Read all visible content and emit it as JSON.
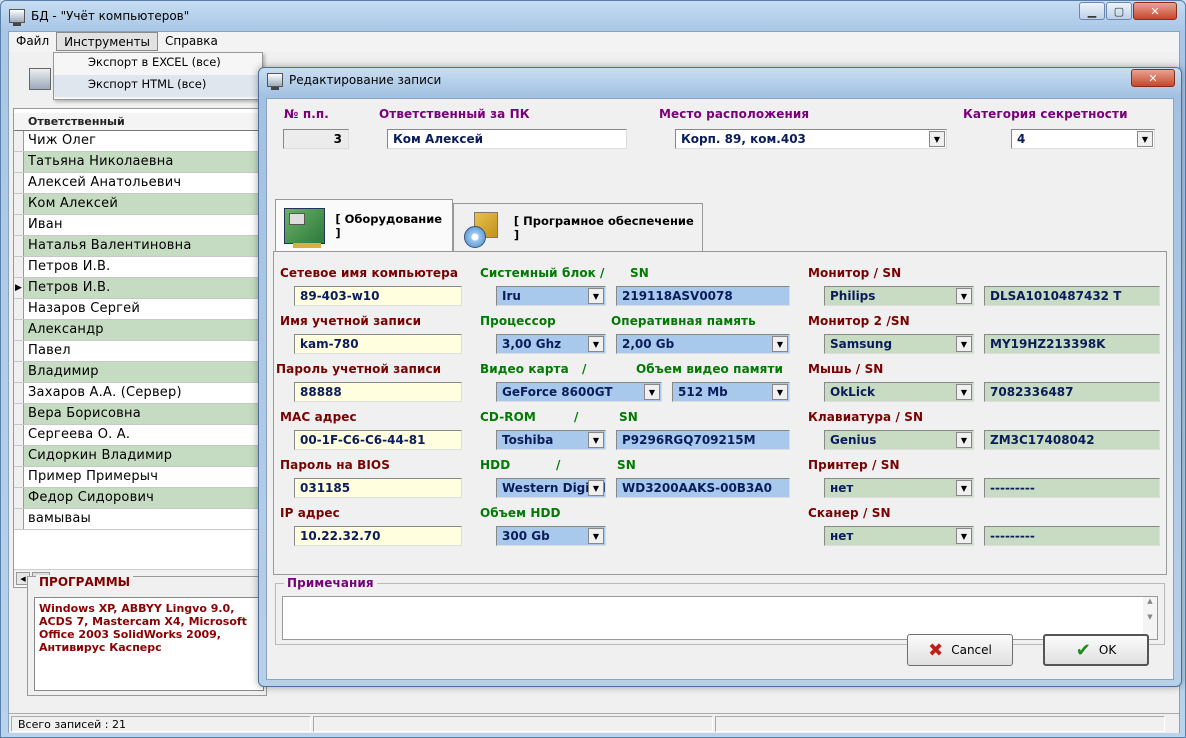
{
  "window": {
    "title": "БД -  \"Учёт компьютеров\""
  },
  "menu": [
    "Файл",
    "Инструменты",
    "Справка"
  ],
  "dropdown": [
    "Экспорт в EXCEL (все)",
    "Экспорт HTML (все)"
  ],
  "list": {
    "header": "Ответственный",
    "rows": [
      "Чиж Олег",
      "Татьяна Николаевна",
      "Алексей Анатольевич",
      "Ком Алексей",
      "Иван",
      "Наталья Валентиновна",
      "Петров И.В.",
      "Петров И.В.",
      "Назаров Сергей",
      "Александр",
      "Павел",
      "Владимир",
      "Захаров А.А. (Сервер)",
      "Вера Борисовна",
      "Сергеева О. А.",
      "Сидоркин Владимир",
      "Пример Примерыч",
      "Федор Сидорович",
      "вамываы"
    ],
    "current_indicator": "▶"
  },
  "programs": {
    "title": "ПРОГРАММЫ",
    "text": "Windows XP, ABBYY Lingvo 9.0, ACDS 7, Mastercam X4, Microsoft Office 2003 SolidWorks 2009, Антивирус Касперс"
  },
  "status": {
    "records": "Всего записей : 21"
  },
  "dialog": {
    "title": "Редактирование записи",
    "num_label": "№ п.п.",
    "num_value": "3",
    "resp_label": "Ответственный за ПК",
    "resp_value": "Ком Алексей",
    "loc_label": "Место расположения",
    "loc_value": "Корп. 89, ком.403",
    "sec_label": "Категория секретности",
    "sec_value": "4",
    "tabs": [
      "[  Оборудование  ]",
      "[  Програмное обеспечение  ]"
    ],
    "left": [
      {
        "label": "Сетевое имя компьютера",
        "value": "89-403-w10"
      },
      {
        "label": "Имя учетной записи",
        "value": "kam-780"
      },
      {
        "label": "Пароль учетной записи",
        "value": "88888"
      },
      {
        "label": "MAC адрес",
        "value": "00-1F-C6-C6-44-81"
      },
      {
        "label": "Пароль на BIOS",
        "value": "031185"
      },
      {
        "label": "IP адрес",
        "value": "10.22.32.70"
      }
    ],
    "mid_labels": [
      "Системный блок",
      "/",
      "SN",
      "Процессор",
      "Оперативная память",
      "Видео карта",
      "/",
      "Объем видео памяти",
      "CD-ROM",
      "/",
      "SN",
      "HDD",
      "/",
      "SN",
      "Объем HDD"
    ],
    "mid": {
      "sysblock": "Iru",
      "sysblock_sn": "219118ASV0078",
      "cpu": "3,00 Ghz",
      "ram": "2,00 Gb",
      "gpu": "GeForce 8600GT",
      "vram": "512 Mb",
      "cdrom": "Toshiba",
      "cdrom_sn": "P9296RGQ709215M",
      "hdd": "Western Digital",
      "hdd_sn": "WD3200AAKS-00B3A0",
      "hdd_size": "300 Gb"
    },
    "right": [
      {
        "label": "Монитор / SN",
        "value": "Philips",
        "sn": "DLSA1010487432 T"
      },
      {
        "label": "Монитор 2 /SN",
        "value": "Samsung",
        "sn": "MY19HZ213398K"
      },
      {
        "label": "Мышь / SN",
        "value": "OkLick",
        "sn": "7082336487"
      },
      {
        "label": "Клавиатура / SN",
        "value": "Genius",
        "sn": "ZM3C17408042"
      },
      {
        "label": "Принтер / SN",
        "value": "нет",
        "sn": "---------"
      },
      {
        "label": "Сканер / SN",
        "value": "нет",
        "sn": "---------"
      }
    ],
    "notes_label": "Примечания",
    "cancel": "Cancel",
    "ok": "OK"
  }
}
